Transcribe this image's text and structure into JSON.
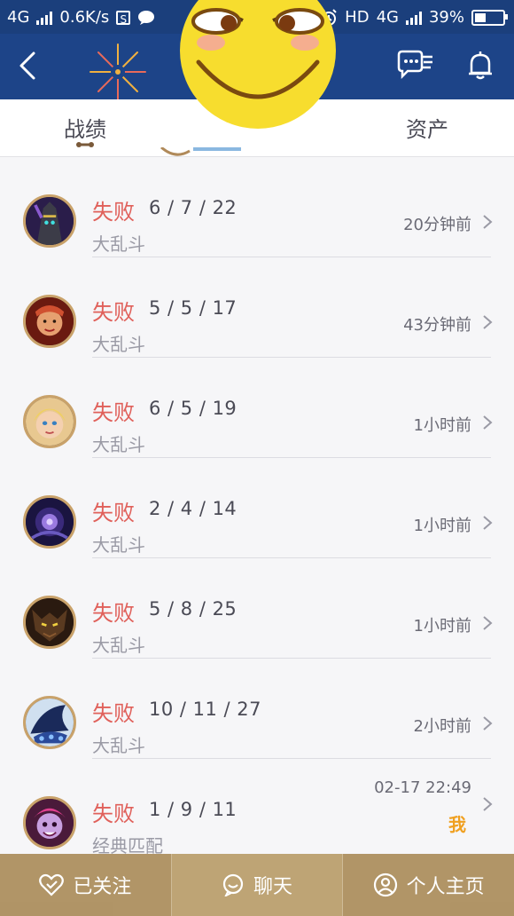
{
  "status_bar": {
    "network": "4G",
    "speed": "0.6K/s",
    "s_badge": "S",
    "hd": "HD",
    "network_right": "4G",
    "battery": "39%",
    "battery_level": 0.39
  },
  "tabs": [
    "战绩",
    "",
    "资产"
  ],
  "matches": [
    {
      "result": "失败",
      "kda": "6 / 7 / 22",
      "mode": "大乱斗",
      "time": "20分钟前"
    },
    {
      "result": "失败",
      "kda": "5 / 5 / 17",
      "mode": "大乱斗",
      "time": "43分钟前"
    },
    {
      "result": "失败",
      "kda": "6 / 5 / 19",
      "mode": "大乱斗",
      "time": "1小时前"
    },
    {
      "result": "失败",
      "kda": "2 / 4 / 14",
      "mode": "大乱斗",
      "time": "1小时前"
    },
    {
      "result": "失败",
      "kda": "5 / 8 / 25",
      "mode": "大乱斗",
      "time": "1小时前"
    },
    {
      "result": "失败",
      "kda": "10 / 11 / 27",
      "mode": "大乱斗",
      "time": "2小时前"
    },
    {
      "result": "失败",
      "kda": "1 / 9 / 11",
      "mode": "经典匹配",
      "time": "02-17 22:49",
      "badge": "我"
    }
  ],
  "bottom_bar": {
    "follow": "已关注",
    "chat": "聊天",
    "profile": "个人主页"
  },
  "colors": {
    "nav_blue": "#1d4488",
    "loss_red": "#e0605a",
    "bottom_gold": "#aa8c5a"
  }
}
